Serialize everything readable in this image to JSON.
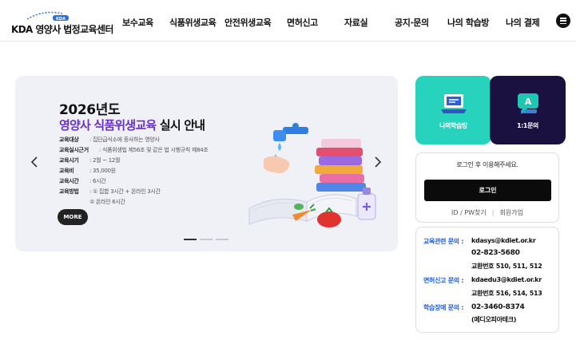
{
  "header": {
    "logo": {
      "badge": "KDA",
      "text": "KDA 영양사 법정교육센터"
    },
    "nav": [
      "보수교육",
      "식품위생교육",
      "안전위생교육",
      "면허신고",
      "자료실",
      "공지·문의",
      "나의 학습방",
      "나의 결제"
    ]
  },
  "banner": {
    "year": "2026년도",
    "title_highlight": "영양사 식품위생교육",
    "title_rest": " 실시 안내",
    "rows": [
      {
        "key": "교육대상",
        "value": ": 집단급식소에 종사하는 영양사"
      },
      {
        "key": "교육실시근거",
        "value": ": 식품위생법 제56조 및 같은 법 시행규칙 제84조"
      },
      {
        "key": "교육시기",
        "value": ": 2월 ~ 12월"
      },
      {
        "key": "교육비",
        "value": ": 35,000원"
      },
      {
        "key": "교육시간",
        "value": ": 6시간"
      },
      {
        "key": "교육방법",
        "value": ": ① 집합 3시간 + 온라인 3시간"
      },
      {
        "key": "",
        "value": "  ② 온라인 6시간"
      }
    ],
    "more_label": "MORE",
    "slide_count": 3,
    "active_slide": 1
  },
  "quick": {
    "study": {
      "label": "나의학습방",
      "icon": "laptop-icon",
      "color": "#27d3bc"
    },
    "inquiry": {
      "label": "1:1문의",
      "icon": "chat-icon",
      "color": "#1a1140"
    }
  },
  "login": {
    "message": "로그인 후 이용해주세요.",
    "button": "로그인",
    "find": "ID / PW찾기",
    "join": "회원가입"
  },
  "contact": {
    "edu_label": "교육관련 문의 :",
    "edu_email": "kdasys@kdiet.or.kr",
    "edu_phone": "02-823-5680",
    "edu_ext": "교환번호 510, 511, 512",
    "license_label": "면허신고 문의 :",
    "license_email": "kdaedu3@kdiet.or.kr",
    "license_ext": "교환번호 516, 514, 513",
    "error_label": "학습장애 문의 :",
    "error_phone": "02-3460-8374",
    "error_company": "(메디오피아테크)"
  }
}
